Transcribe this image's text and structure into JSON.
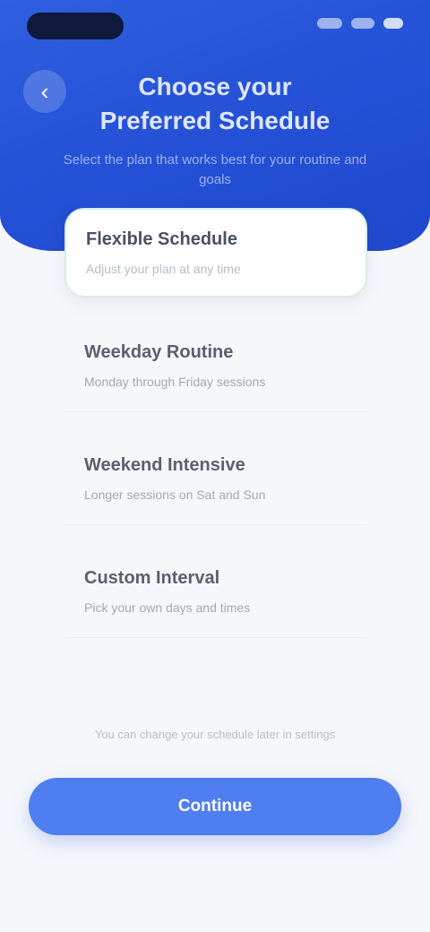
{
  "header": {
    "title": "Choose your Preferred Schedule",
    "subtitle": "Select the plan that works best for your routine and goals",
    "back_icon": "chevron-left-icon"
  },
  "options": [
    {
      "title": "Flexible Schedule",
      "description": "Adjust your plan at any time"
    },
    {
      "title": "Weekday Routine",
      "description": "Monday through Friday sessions"
    },
    {
      "title": "Weekend Intensive",
      "description": "Longer sessions on Sat and Sun"
    },
    {
      "title": "Custom Interval",
      "description": "Pick your own days and times"
    }
  ],
  "footer": {
    "note": "You can change your schedule later in settings",
    "continue_label": "Continue"
  },
  "colors": {
    "header": "#2350d6",
    "primary": "#4e7ef0",
    "selected_border": "#d9eee3"
  }
}
